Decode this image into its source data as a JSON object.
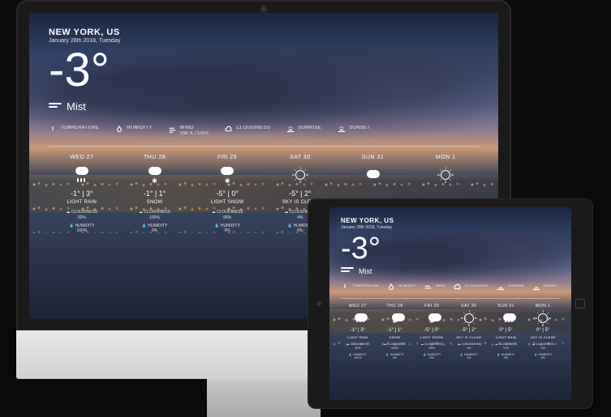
{
  "location": "NEW YORK, US",
  "date": "January 28th 2018, Tuesday",
  "current": {
    "temp": "-3°",
    "condition": "Mist"
  },
  "stats": {
    "temperature": {
      "label": "TEMPERATURE",
      "value": ""
    },
    "humidity": {
      "label": "HUMIDITY",
      "value": ""
    },
    "wind": {
      "label": "WIND",
      "value": "SW 4.71m/s"
    },
    "cloudiness": {
      "label": "CLOUDINESS",
      "value": ""
    },
    "sunrise": {
      "label": "SUNRISE",
      "value": ""
    },
    "sunset": {
      "label": "SUNSET",
      "value": ""
    }
  },
  "forecast_desktop": [
    {
      "day": "WED 27",
      "icon": "cloud-rain",
      "temp": "-1° | 3°",
      "cond": "LIGHT RAIN",
      "cloudiness_label": "☁ CLOUDINESS",
      "cloudiness": "92%",
      "humidity_label": "💧 HUMIDITY",
      "humidity": "100%"
    },
    {
      "day": "THU 28",
      "icon": "snow",
      "temp": "-1° | 1°",
      "cond": "SNOW",
      "cloudiness_label": "☁ CLOUDINESS",
      "cloudiness": "100%",
      "humidity_label": "💧 HUMIDITY",
      "humidity": "0%"
    },
    {
      "day": "FRI 29",
      "icon": "snow",
      "temp": "-5° | 0°",
      "cond": "LIGHT SNOW",
      "cloudiness_label": "☁ CLOUDINESS",
      "cloudiness": "96%",
      "humidity_label": "💧 HUMIDITY",
      "humidity": "0%"
    },
    {
      "day": "SAT 30",
      "icon": "sun",
      "temp": "-5° | 2°",
      "cond": "SKY IS CLEAR",
      "cloudiness_label": "☁ CLOUDINESS",
      "cloudiness": "4%",
      "humidity_label": "💧 HUMIDITY",
      "humidity": "0%"
    },
    {
      "day": "SUN 31",
      "icon": "cloud",
      "temp": "",
      "cond": "",
      "cloudiness_label": "",
      "cloudiness": "",
      "humidity_label": "",
      "humidity": ""
    },
    {
      "day": "MON 1",
      "icon": "sun",
      "temp": "",
      "cond": "",
      "cloudiness_label": "",
      "cloudiness": "",
      "humidity_label": "",
      "humidity": ""
    }
  ],
  "forecast_tablet": [
    {
      "day": "WED 27",
      "icon": "cloud-rain",
      "temp": "-1° | 3°",
      "cond": "LIGHT RAIN",
      "cloudiness_label": "☁ CLOUDINESS",
      "cloudiness": "92%",
      "humidity_label": "💧 HUMIDITY",
      "humidity": "100%"
    },
    {
      "day": "THU 28",
      "icon": "snow",
      "temp": "-1° | 1°",
      "cond": "SNOW",
      "cloudiness_label": "☁ CLOUDINESS",
      "cloudiness": "100%",
      "humidity_label": "💧 HUMIDITY",
      "humidity": "0%"
    },
    {
      "day": "FRI 29",
      "icon": "snow",
      "temp": "-5° | 0°",
      "cond": "LIGHT SNOW",
      "cloudiness_label": "☁ CLOUDINESS",
      "cloudiness": "96%",
      "humidity_label": "💧 HUMIDITY",
      "humidity": "0%"
    },
    {
      "day": "SAT 30",
      "icon": "sun",
      "temp": "-5° | 2°",
      "cond": "SKY IS CLEAR",
      "cloudiness_label": "☁ CLOUDINESS",
      "cloudiness": "4%",
      "humidity_label": "💧 HUMIDITY",
      "humidity": "0%"
    },
    {
      "day": "SUN 31",
      "icon": "cloud-rain",
      "temp": "0° | 5°",
      "cond": "LIGHT RAIN",
      "cloudiness_label": "☁ CLOUDINESS",
      "cloudiness": "17%",
      "humidity_label": "💧 HUMIDITY",
      "humidity": "0%"
    },
    {
      "day": "MON 1",
      "icon": "sun",
      "temp": "0° | 5°",
      "cond": "SKY IS CLEAR",
      "cloudiness_label": "☁ CLOUDINESS",
      "cloudiness": "1%",
      "humidity_label": "💧 HUMIDITY",
      "humidity": "0%"
    }
  ]
}
